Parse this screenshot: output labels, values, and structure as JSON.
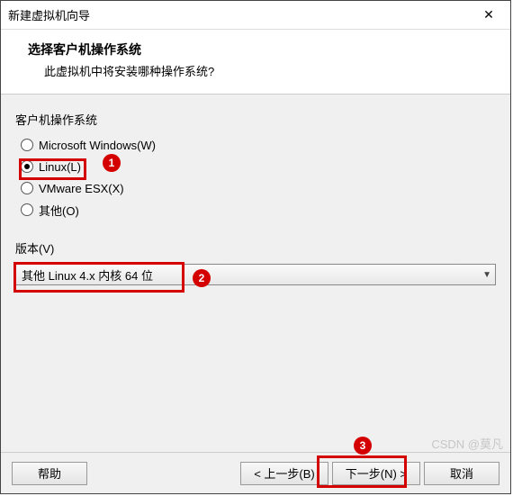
{
  "window": {
    "title": "新建虚拟机向导",
    "close": "✕"
  },
  "header": {
    "heading": "选择客户机操作系统",
    "subheading": "此虚拟机中将安装哪种操作系统?"
  },
  "os_group": {
    "label": "客户机操作系统",
    "options": [
      {
        "label": "Microsoft Windows(W)",
        "selected": false
      },
      {
        "label": "Linux(L)",
        "selected": true
      },
      {
        "label": "VMware ESX(X)",
        "selected": false
      },
      {
        "label": "其他(O)",
        "selected": false
      }
    ]
  },
  "version": {
    "label": "版本(V)",
    "selected": "其他 Linux 4.x 内核 64 位"
  },
  "footer": {
    "help": "帮助",
    "back": "< 上一步(B)",
    "next": "下一步(N) >",
    "cancel": "取消"
  },
  "annotations": {
    "badge1": "1",
    "badge2": "2",
    "badge3": "3"
  },
  "watermark": "CSDN @莫凡"
}
